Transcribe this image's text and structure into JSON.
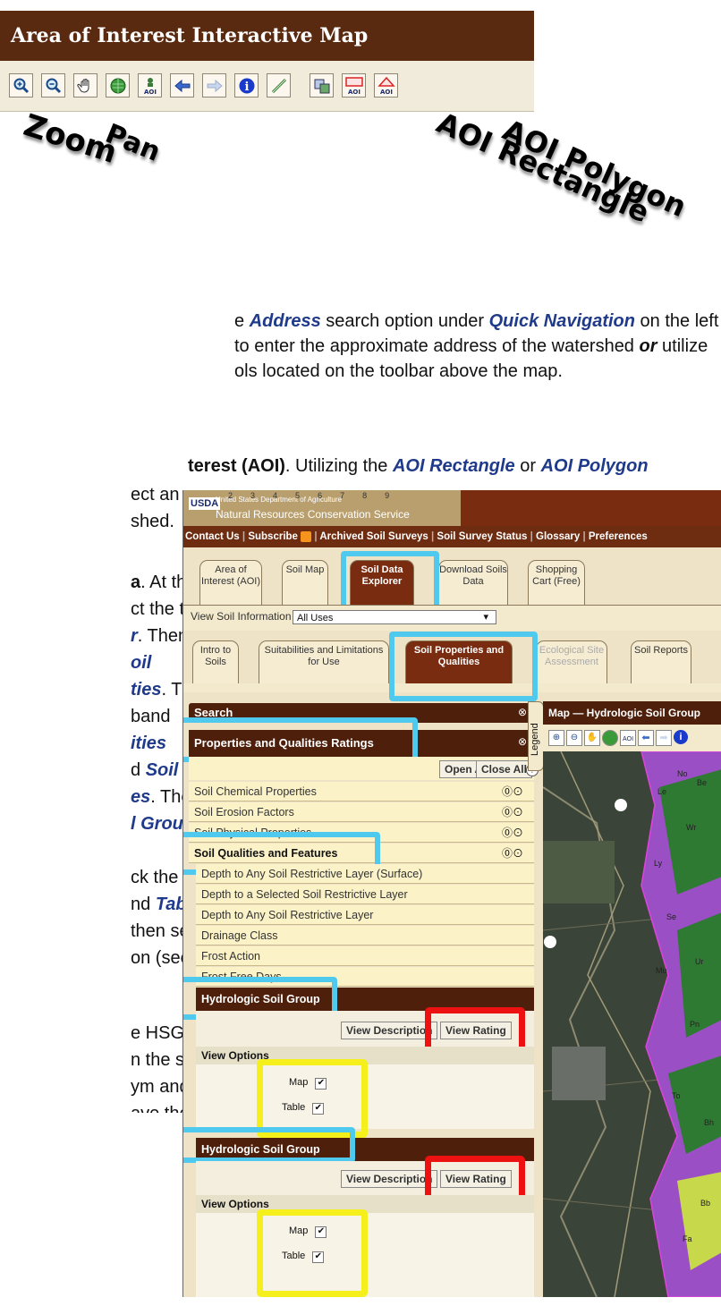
{
  "aoi_panel": {
    "title": "Area of Interest Interactive Map",
    "toolbar_icons": [
      "zoom-in-icon",
      "zoom-out-icon",
      "pan-hand-icon",
      "full-extent-globe-icon",
      "aoi-person-icon",
      "back-arrow-icon",
      "forward-arrow-icon",
      "info-icon",
      "measure-ruler-icon",
      "layers-icon",
      "aoi-rectangle-icon",
      "aoi-polygon-icon"
    ],
    "aoi_glyph": "AOI"
  },
  "annotations": {
    "zoom": "Zoom",
    "pan": "Pan",
    "aoi_polygon": "AOI Polygon",
    "aoi_rectangle": "AOI Rectangle"
  },
  "body_text": {
    "l1_a": "e ",
    "l1_address": "Address",
    "l1_b": " search option under ",
    "l1_quicknav": "Quick Navigation",
    "l1_c": " on the left",
    "l2_a": "to enter the approximate address of the watershed ",
    "l2_or": "or",
    "l2_b": " utilize",
    "l3": "ols located on the toolbar above the map.",
    "l4_a": "terest (AOI)",
    "l4_b": ". Utilizing the ",
    "l4_rect": "AOI Rectangle",
    "l4_c": " or ",
    "l4_poly": "AOI Polygon",
    "l5": "ect an area",
    "l6": "shed.",
    "l7_a": "a",
    "l7_b": ". At the top",
    "l8": "ct the third",
    "l9_a": "r",
    "l9_b": ". Then",
    "l10": "oil",
    "l11_a": "ties",
    "l11_b": ". Then",
    "l12": "band",
    "l13": "ities",
    "l14_a": "d ",
    "l14_b": "Soil",
    "l15_a": "es",
    "l15_b": ". Then",
    "l16_a": "l Group",
    "l16_b": ".",
    "l17": "ck the",
    "l18_a": "nd ",
    "l18_b": "Table",
    "l19": "then select",
    "l20": "on (see red",
    "l21": "e HSG, a",
    "l22": "n the soil",
    "l23": "ym and the",
    "l24": "ave the"
  },
  "wss": {
    "usda_line1": "United States Department of Agriculture",
    "usda_line2": "Natural Resources Conservation Service",
    "usda_logo": "USDA",
    "ruler_numbers": [
      "2",
      "3",
      "4",
      "5",
      "6",
      "7",
      "8",
      "9"
    ],
    "nav": [
      "Contact Us",
      "Subscribe",
      "Archived Soil Surveys",
      "Soil Survey Status",
      "Glossary",
      "Preferences"
    ],
    "tabs": [
      {
        "label": "Area of Interest (AOI)"
      },
      {
        "label": "Soil Map"
      },
      {
        "label": "Soil Data Explorer"
      },
      {
        "label": "Download Soils Data"
      },
      {
        "label": "Shopping Cart (Free)"
      }
    ],
    "view_by_label": "View Soil Information By Use:",
    "view_by_value": "All Uses",
    "subtabs": [
      {
        "label": "Intro to Soils"
      },
      {
        "label": "Suitabilities and Limitations for Use"
      },
      {
        "label": "Soil Properties and Qualities"
      },
      {
        "label": "Ecological Site Assessment"
      },
      {
        "label": "Soil Reports"
      }
    ],
    "search_label": "Search",
    "pq_ratings": "Properties and Qualities Ratings",
    "open_all": "Open All",
    "close_all": "Close All",
    "categories": [
      "Soil Chemical Properties",
      "Soil Erosion Factors",
      "Soil Physical Properties"
    ],
    "sqf": "Soil Qualities and Features",
    "sqf_items": [
      "Depth to Any Soil Restrictive Layer (Surface)",
      "Depth to a Selected Soil Restrictive Layer",
      "Depth to Any Soil Restrictive Layer",
      "Drainage Class",
      "Frost Action",
      "Frost Free Days"
    ],
    "hsg": "Hydrologic Soil Group",
    "view_description": "View Description",
    "view_rating": "View Rating",
    "view_options": "View Options",
    "map_label": "Map",
    "table_label": "Table",
    "legend_tab": "Legend",
    "map_title": "Map — Hydrologic Soil Group",
    "map_labels": [
      "No",
      "Le",
      "Be",
      "Wr",
      "Ly",
      "Se",
      "Mu",
      "Ur",
      "Pn",
      "To",
      "Bh",
      "Bb",
      "Fa"
    ]
  }
}
